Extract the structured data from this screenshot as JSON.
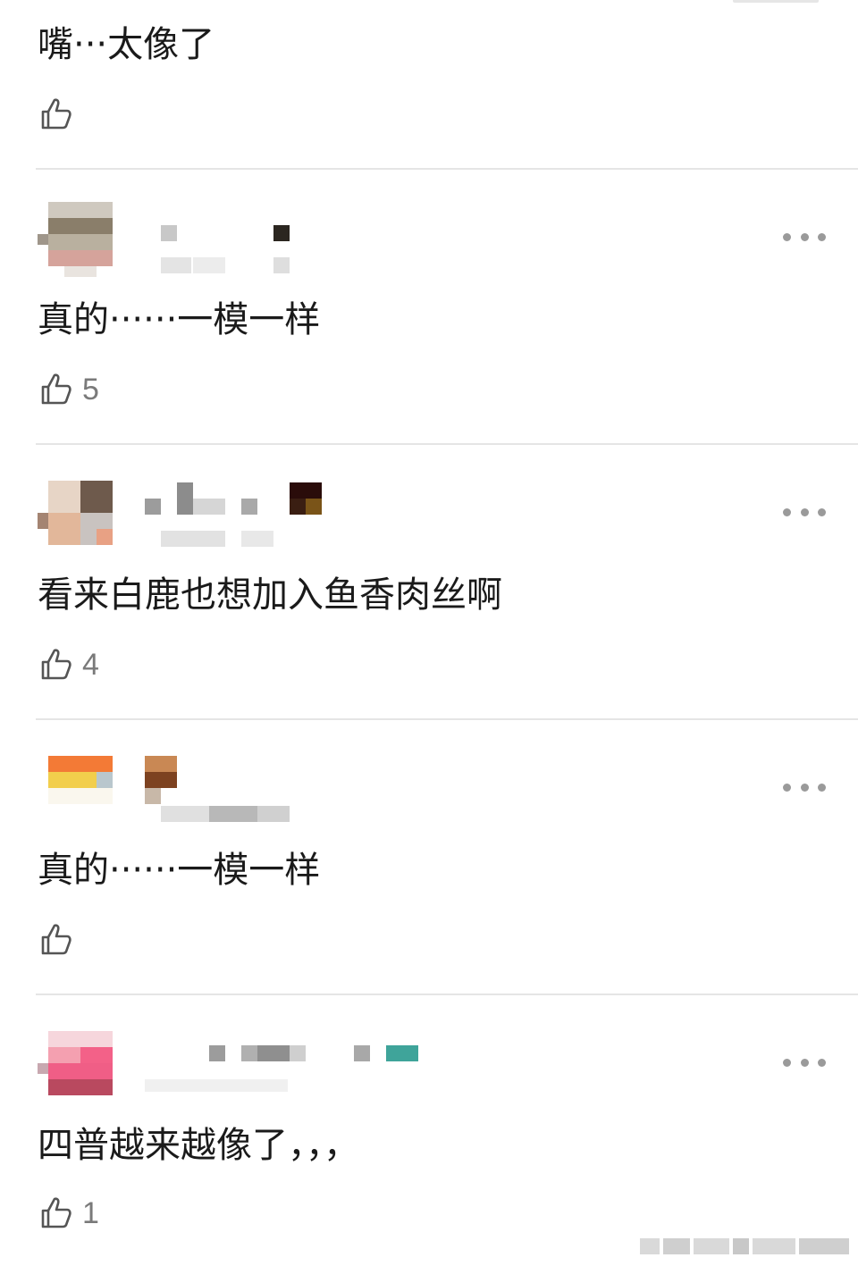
{
  "comments": [
    {
      "text": "嘴···太像了",
      "likes": ""
    },
    {
      "text": "真的······一模一样",
      "likes": "5"
    },
    {
      "text": "看来白鹿也想加入鱼香肉丝啊",
      "likes": "4"
    },
    {
      "text": "真的······一模一样",
      "likes": ""
    },
    {
      "text": "四普越来越像了，，，",
      "likes": "1"
    }
  ],
  "icons": {
    "like": "thumbs-up-icon",
    "more": "more-dots-icon"
  },
  "colors": {
    "text": "#1a1a1a",
    "muted": "#7a7a7a",
    "divider": "#e5e5e5",
    "dots": "#9a9a9a"
  }
}
